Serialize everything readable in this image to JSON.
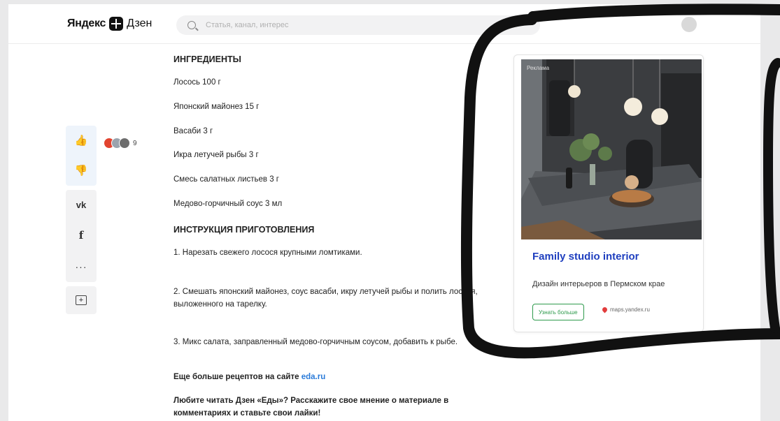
{
  "header": {
    "logo_brand": "Яндекс",
    "logo_product": "Дзен",
    "search_placeholder": "Статья, канал, интерес"
  },
  "rail": {
    "like_icon": "👍",
    "dislike_icon": "👎",
    "vk_label": "vk",
    "fb_label": "f",
    "more_label": "···",
    "save_label": "+",
    "like_count": "9"
  },
  "article": {
    "ingredients_heading": "ИНГРЕДИЕНТЫ",
    "ingredients": [
      "Лосось 100 г",
      "Японский майонез 15 г",
      "Васаби 3 г",
      "Икра летучей рыбы 3 г",
      "Смесь салатных листьев 3 г",
      "Медово-горчичный соус 3 мл"
    ],
    "instructions_heading": "ИНСТРУКЦИЯ ПРИГОТОВЛЕНИЯ",
    "steps": [
      "1. Нарезать свежего лосося крупными ломтиками.",
      "2. Смешать японский майонез, соус васаби, икру летучей рыбы и полить лосося, выложенного на тарелку.",
      "3. Микс салата, заправленный медово-горчичным соусом, добавить к рыбе."
    ],
    "more_recipes_text": "Еще больше рецептов на сайте ",
    "more_recipes_link": "eda.ru",
    "closing_text": "Любите читать Дзен «Еды»? Расскажите свое мнение о материале в комментариях и ставьте свои лайки!"
  },
  "ad": {
    "label": "Реклама",
    "title": "Family studio interior",
    "description": "Дизайн интерьеров в Пермском крае",
    "cta_label": "Узнать больше",
    "domain": "maps.yandex.ru"
  }
}
